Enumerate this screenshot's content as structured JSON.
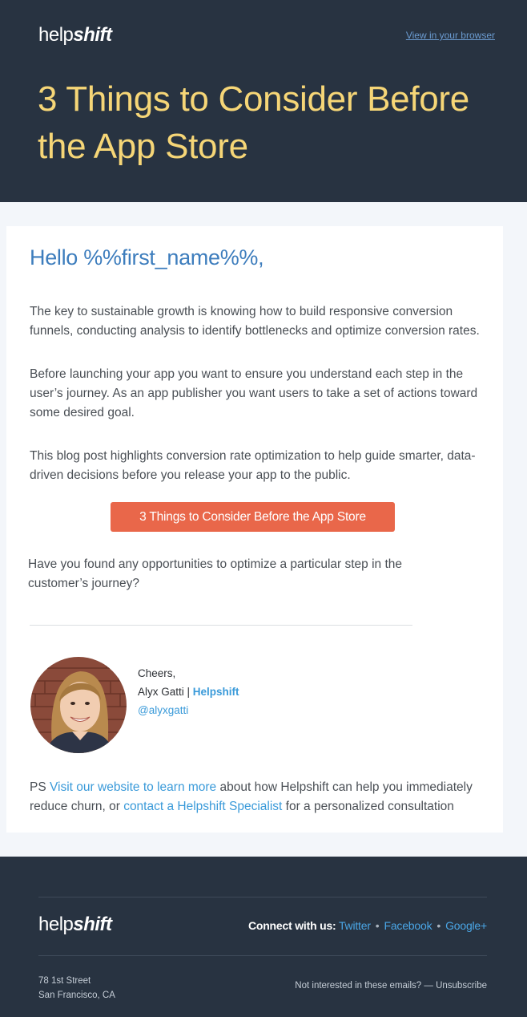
{
  "header": {
    "logo_light": "help",
    "logo_bold": "shift",
    "view_in_browser": "View in your browser",
    "title": "3 Things to Consider Before the App Store"
  },
  "body": {
    "greeting": "Hello %%first_name%%,",
    "paragraph_1": "The key to sustainable growth is knowing how to build responsive conversion funnels, conducting analysis to identify bottlenecks and optimize conversion rates.",
    "paragraph_2": "Before launching your app you want to ensure you understand each step in the user’s journey. As an app publisher you want users to take a set of actions toward some desired goal.",
    "paragraph_3": "This blog post highlights conversion rate optimization to help guide smarter, data-driven decisions before you release your app to the public.",
    "cta_label": "3 Things to Consider Before the App Store",
    "question": "Have you found any opportunities to optimize a particular step in the customer’s journey?"
  },
  "signature": {
    "closing": "Cheers,",
    "name": "Alyx Gatti",
    "separator": " | ",
    "company": "Helpshift",
    "handle": "@alyxgatti"
  },
  "ps": {
    "prefix": "PS ",
    "link_1": "Visit our website to learn more",
    "middle": " about how Helpshift can help you immediately reduce churn, or ",
    "link_2": "contact a Helpshift Specialist",
    "suffix": " for a personalized consultation"
  },
  "footer": {
    "logo_light": "help",
    "logo_bold": "shift",
    "connect_label": "Connect with us:",
    "social": [
      "Twitter",
      "Facebook",
      "Google+"
    ],
    "social_separator": "•",
    "address_line_1": "78 1st Street",
    "address_line_2": "San Francisco, CA",
    "unsubscribe_prefix": "Not interested in these emails? — ",
    "unsubscribe_label": "Unsubscribe"
  },
  "colors": {
    "header_bg": "#283341",
    "title_yellow": "#f6d677",
    "greeting_blue": "#3d7dbd",
    "link_blue": "#3a9ad9",
    "cta_orange": "#e9674a"
  }
}
